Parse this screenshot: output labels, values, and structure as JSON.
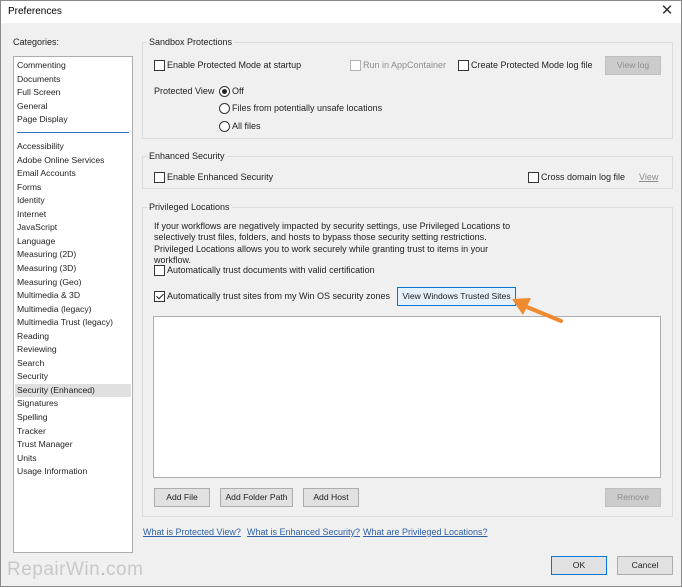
{
  "window": {
    "title": "Preferences",
    "close_glyph": "✕"
  },
  "categories": {
    "label": "Categories:",
    "top_items": [
      "Commenting",
      "Documents",
      "Full Screen",
      "General",
      "Page Display"
    ],
    "items": [
      "Accessibility",
      "Adobe Online Services",
      "Email Accounts",
      "Forms",
      "Identity",
      "Internet",
      "JavaScript",
      "Language",
      "Measuring (2D)",
      "Measuring (3D)",
      "Measuring (Geo)",
      "Multimedia & 3D",
      "Multimedia (legacy)",
      "Multimedia Trust (legacy)",
      "Reading",
      "Reviewing",
      "Search",
      "Security",
      "Security (Enhanced)",
      "Signatures",
      "Spelling",
      "Tracker",
      "Trust Manager",
      "Units",
      "Usage Information"
    ],
    "selected": "Security (Enhanced)"
  },
  "sandbox": {
    "title": "Sandbox Protections",
    "protected_mode": {
      "label": "Enable Protected Mode at startup",
      "checked": false
    },
    "app_container": {
      "label": "Run in AppContainer",
      "checked": false,
      "disabled": true
    },
    "log_file": {
      "label": "Create Protected Mode log file",
      "checked": false
    },
    "view_log_button": "View log",
    "protected_view_label": "Protected View",
    "protected_view_options": [
      "Off",
      "Files from potentially unsafe locations",
      "All files"
    ],
    "protected_view_selected": "Off"
  },
  "enhanced": {
    "title": "Enhanced Security",
    "enable": {
      "label": "Enable Enhanced Security",
      "checked": false
    },
    "cross_domain": {
      "label": "Cross domain log file",
      "checked": false
    },
    "view_link": "View"
  },
  "privileged": {
    "title": "Privileged Locations",
    "description": "If your workflows are negatively impacted by security settings, use Privileged Locations to selectively trust files, folders, and hosts to bypass those security setting restrictions. Privileged Locations allows you to work securely while granting trust to items in your workflow.",
    "trust_cert": {
      "label": "Automatically trust documents with valid certification",
      "checked": false
    },
    "trust_sites": {
      "label": "Automatically trust sites from my Win OS security zones",
      "checked": true
    },
    "view_sites_button": "View Windows Trusted Sites",
    "add_file_button": "Add File",
    "add_folder_button": "Add Folder Path",
    "add_host_button": "Add Host",
    "remove_button": "Remove"
  },
  "links": [
    "What is Protected View?",
    "What is Enhanced Security?",
    "What are Privileged Locations?"
  ],
  "footer": {
    "ok_button": "OK",
    "cancel_button": "Cancel"
  },
  "watermark": {
    "part1": "Repair",
    "part2": "Win",
    "dot": ".",
    "part3": "com"
  },
  "colors": {
    "accent": "#0078d7",
    "link": "#2e5fa6",
    "arrow": "#f08a2e",
    "selection": "#e0e0e0"
  }
}
